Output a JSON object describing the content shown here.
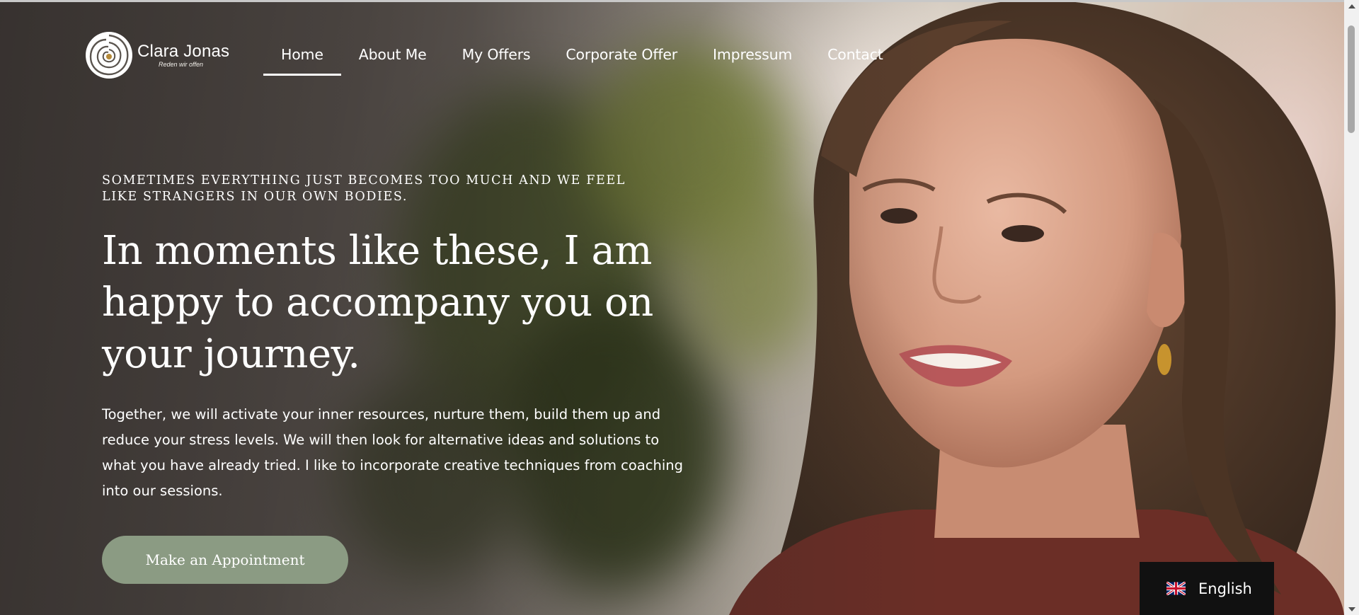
{
  "brand": {
    "name": "Clara Jonas",
    "tagline": "Reden wir offen",
    "logo_icon": "rose-logo-icon"
  },
  "nav": {
    "items": [
      {
        "label": "Home",
        "active": true
      },
      {
        "label": "About Me",
        "active": false
      },
      {
        "label": "My Offers",
        "active": false
      },
      {
        "label": "Corporate Offer",
        "active": false
      },
      {
        "label": "Impressum",
        "active": false
      },
      {
        "label": "Contact",
        "active": false
      }
    ]
  },
  "hero": {
    "eyebrow": "Sometimes everything just becomes too much and we feel like strangers in our own bodies.",
    "headline": "In moments like these, I am happy to accompany you on your journey.",
    "body": "Together, we will activate your inner resources, nurture them, build them up and reduce your stress levels. We will then look for alternative ideas and solutions to what you have already tried. I like to incorporate creative techniques from coaching into our sessions.",
    "cta_label": "Make an Appointment"
  },
  "language": {
    "label": "English",
    "flag_icon": "uk-flag-icon"
  },
  "colors": {
    "cta_background": "#8b9b83",
    "language_switcher_background": "#111111",
    "text": "#ffffff"
  }
}
